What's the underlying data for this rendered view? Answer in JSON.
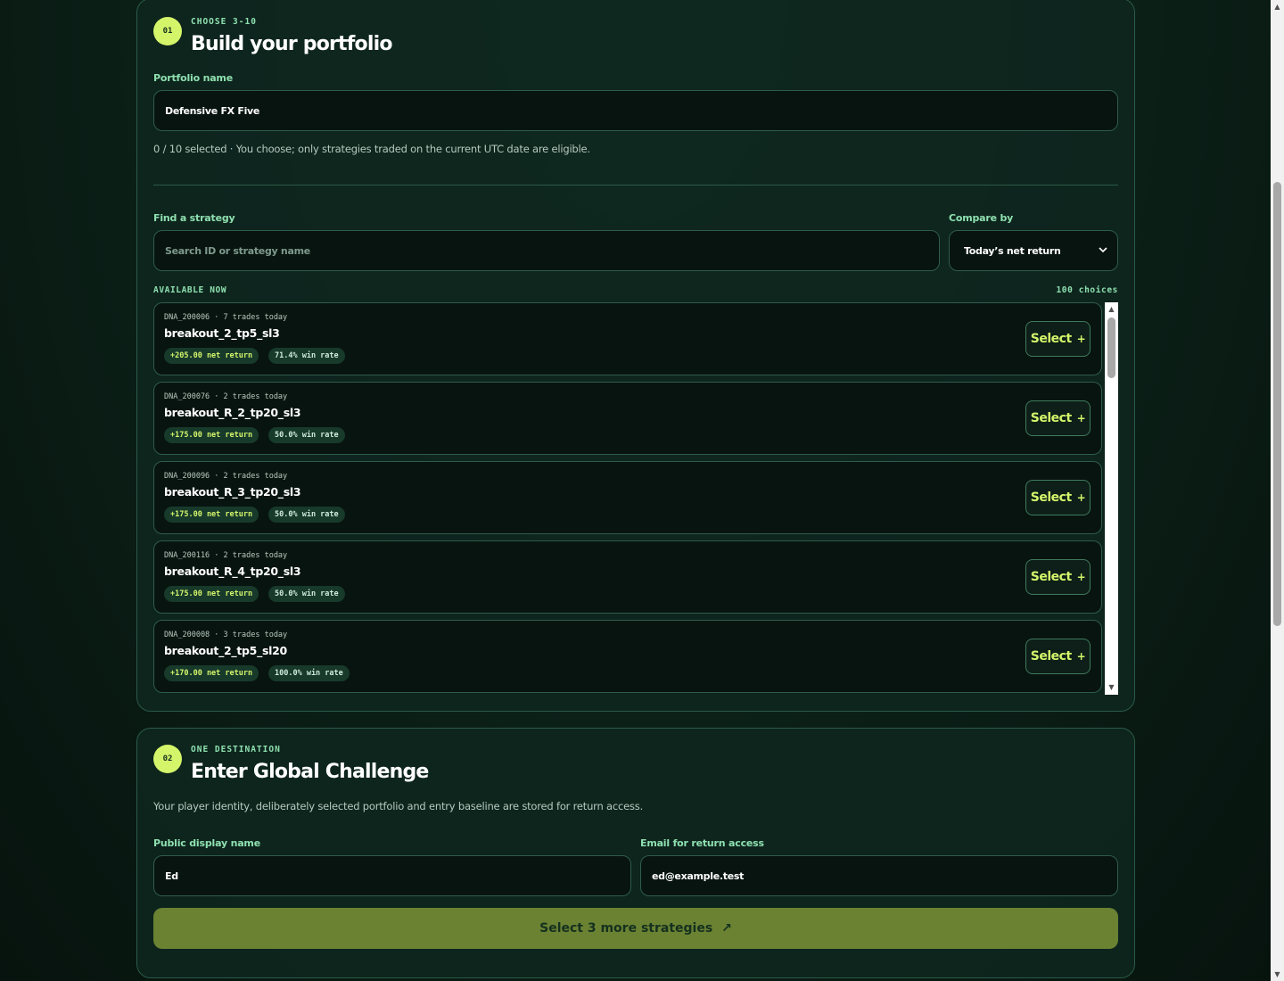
{
  "portfolio_card": {
    "step": "01",
    "eyebrow": "CHOOSE 3-10",
    "title": "Build your portfolio",
    "name_label": "Portfolio name",
    "name_value": "Defensive FX Five",
    "help": "0 / 10 selected · You choose; only strategies traded on the current UTC date are eligible.",
    "search_label": "Find a strategy",
    "search_placeholder": "Search ID or strategy name",
    "compare_label": "Compare by",
    "compare_value": "Today’s net return",
    "available_label": "AVAILABLE NOW",
    "choices_count": "100 choices",
    "select_label": "Select",
    "select_plus": "+",
    "strategies": [
      {
        "meta": "DNA_200006 · 7 trades today",
        "name": "breakout_2_tp5_sl3",
        "net": "+205.00 net return",
        "win": "71.4% win rate"
      },
      {
        "meta": "DNA_200076 · 2 trades today",
        "name": "breakout_R_2_tp20_sl3",
        "net": "+175.00 net return",
        "win": "50.0% win rate"
      },
      {
        "meta": "DNA_200096 · 2 trades today",
        "name": "breakout_R_3_tp20_sl3",
        "net": "+175.00 net return",
        "win": "50.0% win rate"
      },
      {
        "meta": "DNA_200116 · 2 trades today",
        "name": "breakout_R_4_tp20_sl3",
        "net": "+175.00 net return",
        "win": "50.0% win rate"
      },
      {
        "meta": "DNA_200008 · 3 trades today",
        "name": "breakout_2_tp5_sl20",
        "net": "+170.00 net return",
        "win": "100.0% win rate"
      }
    ]
  },
  "challenge_card": {
    "step": "02",
    "eyebrow": "ONE DESTINATION",
    "title": "Enter Global Challenge",
    "help": "Your player identity, deliberately selected portfolio and entry baseline are stored for return access.",
    "display_name_label": "Public display name",
    "display_name_value": "Ed",
    "email_label": "Email for return access",
    "email_value": "ed@example.test",
    "cta_label": "Select 3 more strategies",
    "cta_icon": "↗"
  },
  "colors": {
    "accent": "#d4f56a",
    "label": "#8fe0b0",
    "cta_bg": "#6a8232"
  }
}
